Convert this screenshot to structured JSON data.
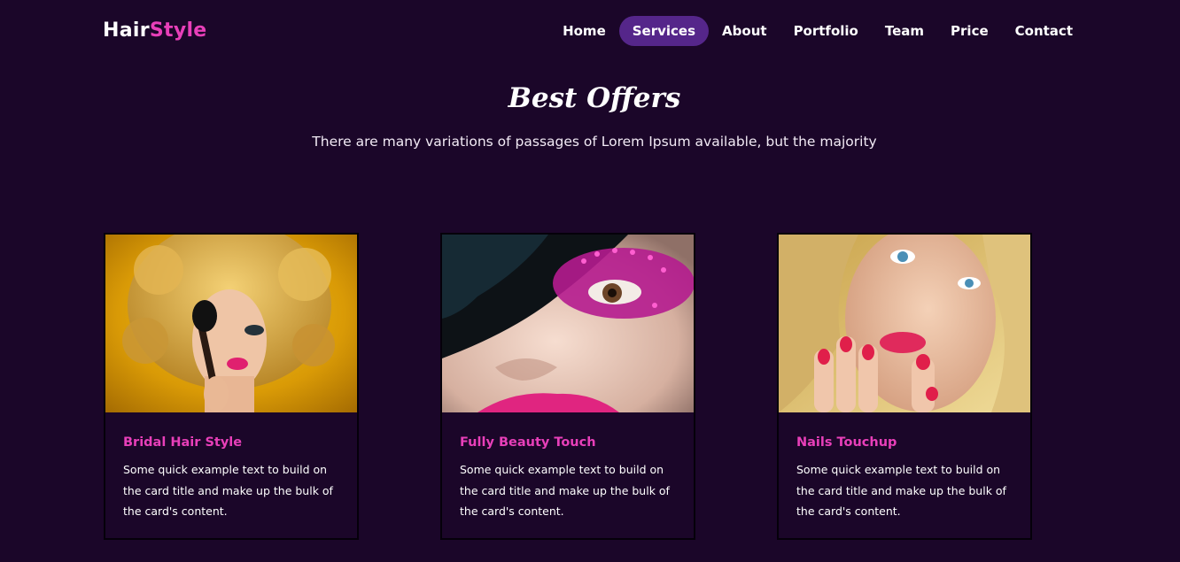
{
  "brand": {
    "part1": "Hair",
    "part2": "Style"
  },
  "nav": {
    "items": [
      {
        "label": "Home"
      },
      {
        "label": "Services"
      },
      {
        "label": "About"
      },
      {
        "label": "Portfolio"
      },
      {
        "label": "Team"
      },
      {
        "label": "Price"
      },
      {
        "label": "Contact"
      }
    ],
    "active": "Services"
  },
  "section": {
    "title": "Best Offers",
    "subtitle": "There are many variations of passages of Lorem Ipsum available, but the majority"
  },
  "cards": [
    {
      "title": "Bridal Hair Style",
      "text": "Some quick example text to build on the card title and make up the bulk of the card's content."
    },
    {
      "title": "Fully Beauty Touch",
      "text": "Some quick example text to build on the card title and make up the bulk of the card's content."
    },
    {
      "title": "Nails Touchup",
      "text": "Some quick example text to build on the card title and make up the bulk of the card's content."
    }
  ],
  "colors": {
    "background": "#1b0629",
    "accent": "#e83fb9",
    "active_pill": "#55268a"
  }
}
